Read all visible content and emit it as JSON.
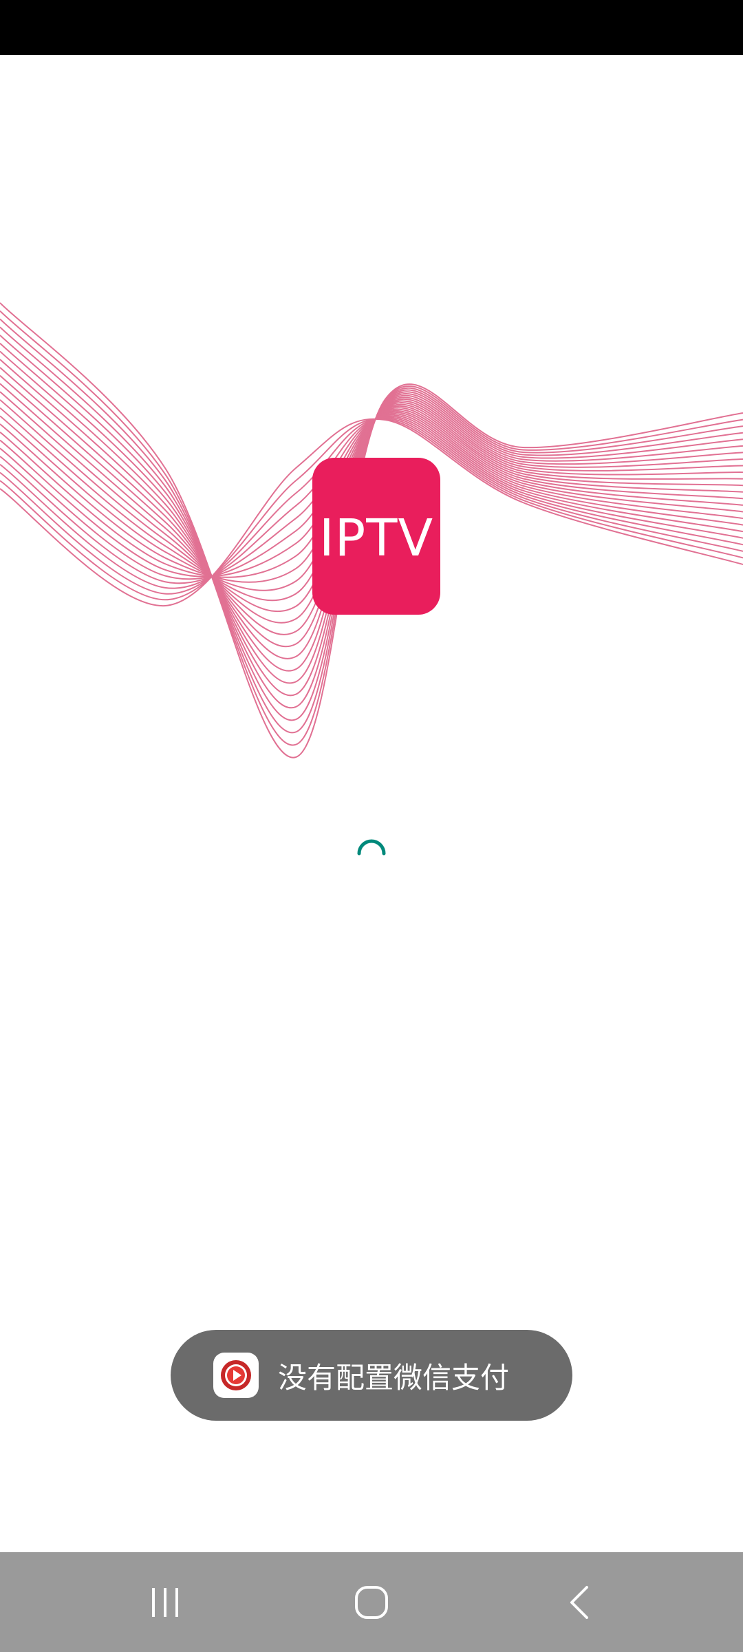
{
  "app": {
    "logo_text": "IPTV",
    "brand_color": "#e91e5c",
    "wave_color": "#e06a8e"
  },
  "loading": {
    "indicator_color": "#00897b"
  },
  "toast": {
    "icon": "video-play-icon",
    "message": "没有配置微信支付"
  },
  "navigation": {
    "recents_icon": "recents-icon",
    "home_icon": "home-icon",
    "back_icon": "back-icon"
  }
}
